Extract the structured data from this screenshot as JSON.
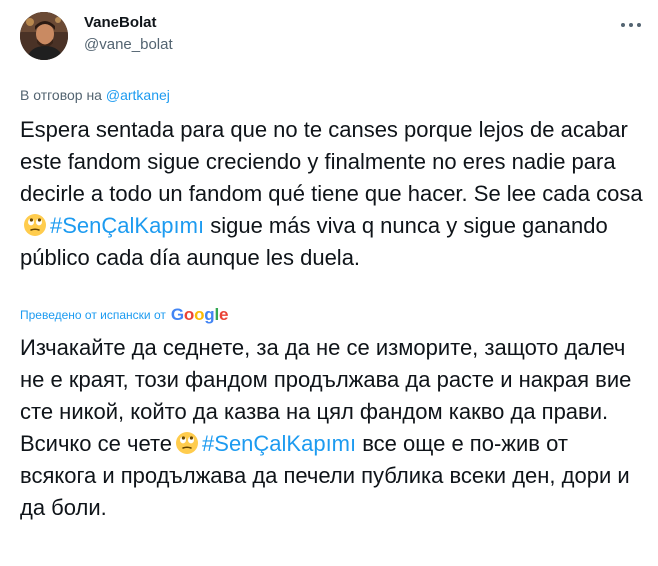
{
  "tweet": {
    "author": {
      "name": "VaneBolat",
      "handle": "@vane_bolat"
    },
    "reply_prefix": "В отговор на ",
    "reply_handle": "@artkanej",
    "original_part1": "Espera sentada para que no te canses porque lejos de acabar este fandom sigue creciendo y finalmente no eres nadie para decirle a todo un fandom qué tiene que hacer. Se lee cada cosa",
    "original_hashtag": "#SenÇalKapımı",
    "original_part2": " sigue más viva q nunca y sigue ganando público cada día aunque les duela.",
    "translated_note": "Преведено от испански от",
    "translated_provider": "Google",
    "translation_part1": "Изчакайте да седнете, за да не се изморите, защото далеч не е краят, този фандом продължава да расте и накрая вие сте никой, който да казва на цял фандом какво да прави. Всичко се чете",
    "translation_hashtag": "#SenÇalKapımı",
    "translation_part2": " все още е по-жив от всякога и продължава да печели публика всеки ден, дори и да боли.",
    "emoji_name": "face-with-rolling-eyes-icon",
    "more_icon_name": "more-options-icon"
  },
  "colors": {
    "link": "#1d9bf0",
    "text": "#0f1419",
    "secondary": "#536471",
    "google_blue": "#4285F4",
    "google_red": "#EA4335",
    "google_yellow": "#FBBC05",
    "google_green": "#34A853"
  }
}
